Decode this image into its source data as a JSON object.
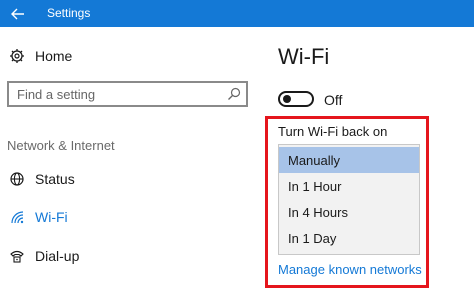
{
  "window": {
    "title": "Settings"
  },
  "sidebar": {
    "home_label": "Home",
    "search": {
      "placeholder": "Find a setting"
    },
    "section_header": "Network & Internet",
    "items": [
      {
        "label": "Status",
        "icon": "globe-icon"
      },
      {
        "label": "Wi-Fi",
        "icon": "wifi-icon",
        "active": true
      },
      {
        "label": "Dial-up",
        "icon": "dialup-icon"
      }
    ]
  },
  "main": {
    "title": "Wi-Fi",
    "toggle": {
      "state_label": "Off",
      "on": false
    },
    "turn_on_label": "Turn Wi-Fi back on",
    "dropdown": {
      "options": [
        "Manually",
        "In 1 Hour",
        "In 4 Hours",
        "In 1 Day"
      ],
      "selected": "Manually"
    },
    "manage_link": "Manage known networks"
  },
  "colors": {
    "accent": "#1479d6",
    "highlight_box": "#e5151c",
    "selected_option": "#a7c3e8"
  }
}
